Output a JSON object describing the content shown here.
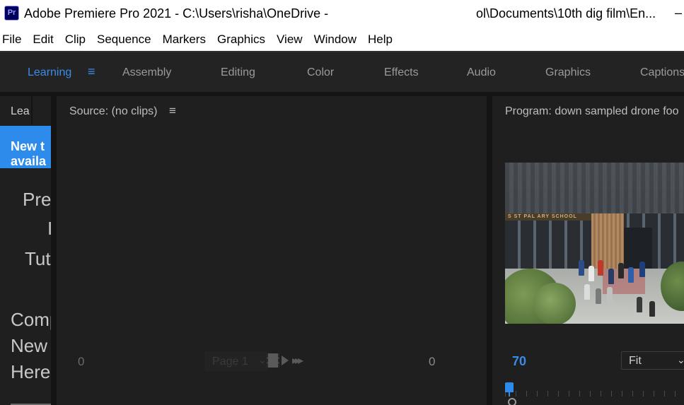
{
  "window": {
    "app_icon_label": "Pr",
    "title": "Adobe Premiere Pro 2021 - C:\\Users\\risha\\OneDrive - ",
    "title_tail": "ol\\Documents\\10th dig film\\En...",
    "minimize": "–"
  },
  "menu": {
    "items": [
      "File",
      "Edit",
      "Clip",
      "Sequence",
      "Markers",
      "Graphics",
      "View",
      "Window",
      "Help"
    ]
  },
  "workspaces": {
    "tabs": [
      {
        "label": "Learning",
        "active": true
      },
      {
        "label": "Assembly",
        "active": false
      },
      {
        "label": "Editing",
        "active": false
      },
      {
        "label": "Color",
        "active": false
      },
      {
        "label": "Effects",
        "active": false
      },
      {
        "label": "Audio",
        "active": false
      },
      {
        "label": "Graphics",
        "active": false
      },
      {
        "label": "Captions",
        "active": false
      }
    ],
    "menu_icon": "≡",
    "accent_color": "#3b8beb"
  },
  "learning_panel": {
    "tab_label": "Lea",
    "banner_line1": "New t",
    "banner_line2": "availa",
    "text_lines": [
      "Pre",
      "I",
      "Tut",
      "Comp",
      "New",
      "Here"
    ]
  },
  "source_panel": {
    "title": "Source: (no clips)",
    "menu_icon": "≡",
    "timecode_left": "0",
    "timecode_right": "0",
    "page_label": "Page 1",
    "page_chevron": "⌄",
    "step_icon": "▸▸▸"
  },
  "program_panel": {
    "title": "Program: down sampled drone foo",
    "sign_text": "S ST   PAL   ARY SCHOOL",
    "timecode": "70",
    "fit_label": "Fit",
    "fit_chevron": "⌄"
  }
}
